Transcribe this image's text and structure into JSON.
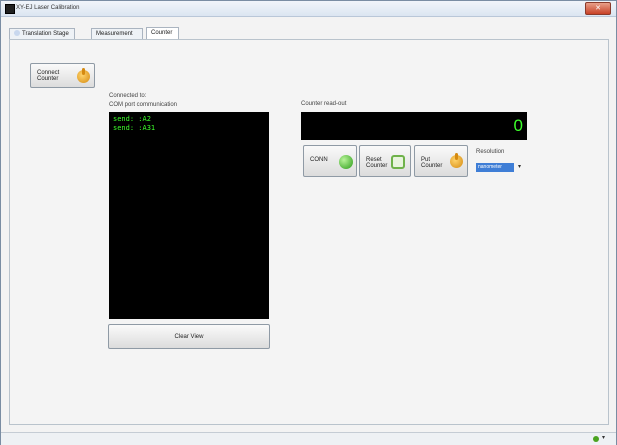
{
  "window": {
    "title": "XY-EJ Laser Calibration",
    "close_glyph": "✕"
  },
  "tabs": [
    {
      "label": "Translation Stage",
      "icon": "stage-icon"
    },
    {
      "label": "Measurement"
    },
    {
      "label": "Counter",
      "active": true
    }
  ],
  "connect_button": {
    "line1": "Connect",
    "line2": "Counter",
    "icon": "hand-icon"
  },
  "left": {
    "connected_label": "Connected to:",
    "com_label": "COM port communication",
    "console_lines": [
      "send: :A2",
      "send: :A31"
    ],
    "clear_button": "Clear View"
  },
  "right": {
    "readout_label": "Counter read-out",
    "readout_value": "0",
    "buttons": {
      "conn_label": "CONN",
      "reset_line1": "Reset",
      "reset_line2": "Counter",
      "put_line1": "Put",
      "put_line2": "Counter"
    },
    "resolution_label": "Resolution",
    "resolution_value": "nanometer",
    "dropdown_glyph": "▾"
  },
  "statusbar": {
    "chevron": "▾"
  },
  "colors": {
    "console_text": "#3cff2a",
    "accent": "#3f7ed6"
  }
}
